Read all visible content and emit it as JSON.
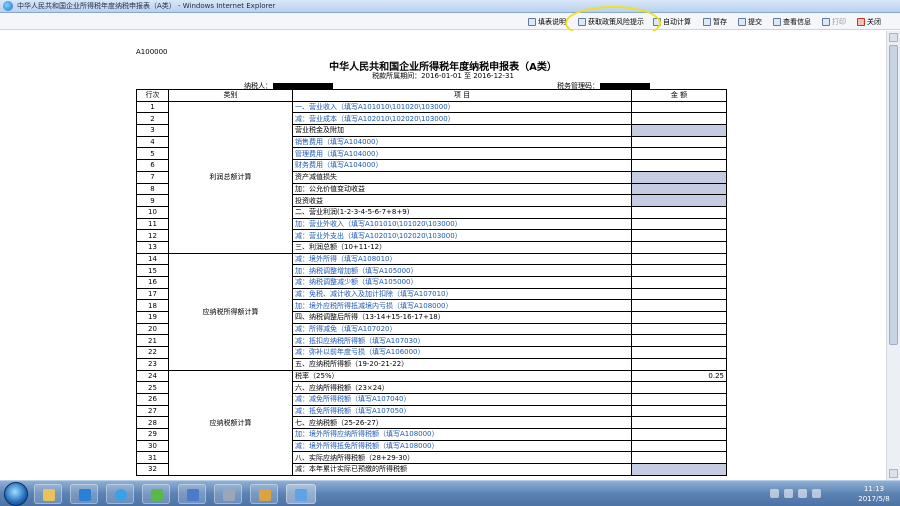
{
  "window": {
    "title": "中华人民共和国企业所得税年度纳税申报表（A类） - Windows Internet Explorer"
  },
  "toolbar": {
    "fill_help": "填表说明",
    "policy_risk": "获取政策风险提示",
    "auto_calc": "自动计算",
    "save": "暂存",
    "submit": "提交",
    "view_info": "查看信息",
    "print": "打印",
    "close": "关闭"
  },
  "form": {
    "code": "A100000",
    "title": "中华人民共和国企业所得税年度纳税申报表（A类）",
    "period": "税款所属期间：2016-01-01 至 2016-12-31",
    "taxpayer_label": "纳税人：",
    "tax_authority_label": "税务管理码："
  },
  "table": {
    "headers": {
      "row_no": "行次",
      "category": "类别",
      "item": "项  目",
      "amount": "金  额"
    },
    "categories": {
      "profit": "利润总额计算",
      "taxable_income": "应纳税所得额计算",
      "tax_payable": "应纳税额计算"
    },
    "rows": [
      {
        "no": "1",
        "text": "一、营业收入（填写A101010\\101020\\103000）",
        "blue": true
      },
      {
        "no": "2",
        "text": "减：营业成本（填写A102010\\102020\\103000）",
        "blue": true
      },
      {
        "no": "3",
        "text": "营业税金及附加"
      },
      {
        "no": "4",
        "text": "销售费用（填写A104000）",
        "blue": true
      },
      {
        "no": "5",
        "text": "管理费用（填写A104000）",
        "blue": true
      },
      {
        "no": "6",
        "text": "财务费用（填写A104000）",
        "blue": true
      },
      {
        "no": "7",
        "text": "资产减值损失"
      },
      {
        "no": "8",
        "text": "加：公允价值变动收益"
      },
      {
        "no": "9",
        "text": "投资收益"
      },
      {
        "no": "10",
        "text": "二、营业利润(1-2-3-4-5-6-7+8+9)"
      },
      {
        "no": "11",
        "text": "加：营业外收入（填写A101010\\101020\\103000）",
        "blue": true
      },
      {
        "no": "12",
        "text": "减：营业外支出（填写A102010\\102020\\103000）",
        "blue": true
      },
      {
        "no": "13",
        "text": "三、利润总额（10+11-12）"
      },
      {
        "no": "14",
        "text": "减：境外所得（填写A108010）",
        "blue": true
      },
      {
        "no": "15",
        "text": "加：纳税调整增加额（填写A105000）",
        "blue": true
      },
      {
        "no": "16",
        "text": "减：纳税调整减少额（填写A105000）",
        "blue": true
      },
      {
        "no": "17",
        "text": "减：免税、减计收入及加计扣除（填写A107010）",
        "blue": true
      },
      {
        "no": "18",
        "text": "加：境外应税所得抵减境内亏损（填写A108000）",
        "blue": true
      },
      {
        "no": "19",
        "text": "四、纳税调整后所得（13-14+15-16-17+18）"
      },
      {
        "no": "20",
        "text": "减：所得减免（填写A107020）",
        "blue": true
      },
      {
        "no": "21",
        "text": "减：抵扣应纳税所得额（填写A107030）",
        "blue": true
      },
      {
        "no": "22",
        "text": "减：弥补以前年度亏损（填写A106000）",
        "blue": true
      },
      {
        "no": "23",
        "text": "五、应纳税所得额（19-20-21-22）"
      },
      {
        "no": "24",
        "text": "税率（25%）",
        "value": "0.25"
      },
      {
        "no": "25",
        "text": "六、应纳所得税额（23×24）"
      },
      {
        "no": "26",
        "text": "减：减免所得税额（填写A107040）",
        "blue": true
      },
      {
        "no": "27",
        "text": "减：抵免所得税额（填写A107050）",
        "blue": true
      },
      {
        "no": "28",
        "text": "七、应纳税额（25-26-27）"
      },
      {
        "no": "29",
        "text": "加：境外所得应纳所得税额（填写A108000）",
        "blue": true
      },
      {
        "no": "30",
        "text": "减：境外所得抵免所得税额（填写A108000）",
        "blue": true
      },
      {
        "no": "31",
        "text": "八、实际应纳所得税额（28+29-30）"
      },
      {
        "no": "32",
        "text": "减：本年累计实际已预缴的所得税额"
      }
    ]
  },
  "clock": {
    "time": "11:13",
    "date": "2017/5/8"
  }
}
